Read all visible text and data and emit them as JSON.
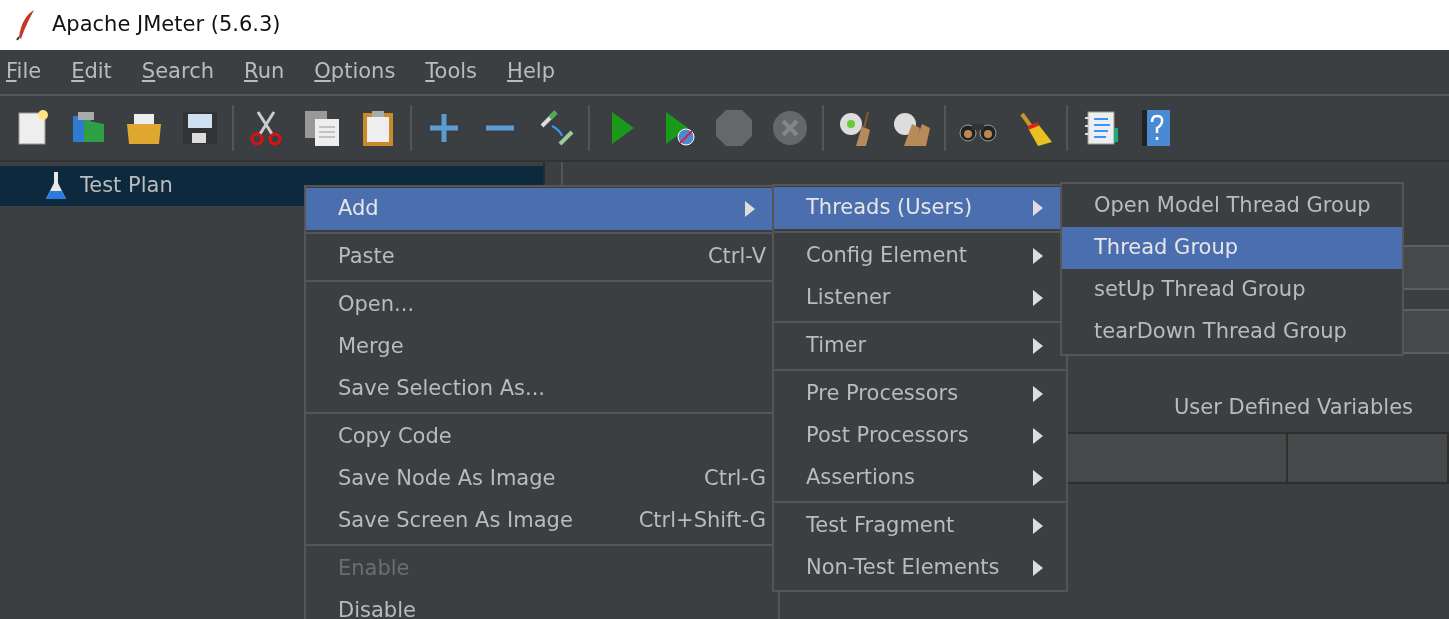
{
  "window": {
    "title": "Apache JMeter (5.6.3)"
  },
  "menu_bar": [
    "File",
    "Edit",
    "Search",
    "Run",
    "Options",
    "Tools",
    "Help"
  ],
  "toolbar": [
    {
      "kind": "new",
      "disabled": false
    },
    {
      "kind": "templates",
      "disabled": false
    },
    {
      "kind": "open",
      "disabled": false
    },
    {
      "kind": "save",
      "disabled": false
    },
    {
      "kind": "separator"
    },
    {
      "kind": "cut",
      "disabled": false
    },
    {
      "kind": "copy",
      "disabled": false
    },
    {
      "kind": "paste",
      "disabled": false
    },
    {
      "kind": "separator"
    },
    {
      "kind": "expand",
      "disabled": false
    },
    {
      "kind": "collapse",
      "disabled": false
    },
    {
      "kind": "toggle",
      "disabled": false
    },
    {
      "kind": "separator"
    },
    {
      "kind": "start",
      "disabled": false
    },
    {
      "kind": "start_no_pause",
      "disabled": false
    },
    {
      "kind": "stop",
      "disabled": true
    },
    {
      "kind": "shutdown",
      "disabled": true
    },
    {
      "kind": "separator"
    },
    {
      "kind": "clear",
      "disabled": false
    },
    {
      "kind": "clear_all",
      "disabled": false
    },
    {
      "kind": "separator"
    },
    {
      "kind": "search",
      "disabled": false
    },
    {
      "kind": "reset_search",
      "disabled": false
    },
    {
      "kind": "separator"
    },
    {
      "kind": "function_helper",
      "disabled": false
    },
    {
      "kind": "help",
      "disabled": false
    }
  ],
  "tree": [
    {
      "label": "Test Plan",
      "selected": true
    }
  ],
  "right_panel": {
    "section_title": "User Defined Variables"
  },
  "context_menu": {
    "items": [
      {
        "kind": "item",
        "label": "Add",
        "selected": true,
        "disabled": false,
        "has_submenu": true
      },
      {
        "kind": "separator"
      },
      {
        "kind": "item",
        "label": "Paste",
        "shortcut": "Ctrl-V",
        "selected": false,
        "disabled": false,
        "has_submenu": false
      },
      {
        "kind": "separator"
      },
      {
        "kind": "item",
        "label": "Open...",
        "selected": false,
        "disabled": false,
        "has_submenu": false
      },
      {
        "kind": "item",
        "label": "Merge",
        "selected": false,
        "disabled": false,
        "has_submenu": false
      },
      {
        "kind": "item",
        "label": "Save Selection As...",
        "selected": false,
        "disabled": false,
        "has_submenu": false
      },
      {
        "kind": "separator"
      },
      {
        "kind": "item",
        "label": "Copy Code",
        "selected": false,
        "disabled": false,
        "has_submenu": false
      },
      {
        "kind": "item",
        "label": "Save Node As Image",
        "shortcut": "Ctrl-G",
        "selected": false,
        "disabled": false,
        "has_submenu": false
      },
      {
        "kind": "item",
        "label": "Save Screen As Image",
        "shortcut": "Ctrl+Shift-G",
        "selected": false,
        "disabled": false,
        "has_submenu": false
      },
      {
        "kind": "separator"
      },
      {
        "kind": "item",
        "label": "Enable",
        "selected": false,
        "disabled": true,
        "has_submenu": false
      },
      {
        "kind": "item",
        "label": "Disable",
        "selected": false,
        "disabled": false,
        "has_submenu": false
      }
    ]
  },
  "add_submenu": {
    "items": [
      {
        "kind": "item",
        "label": "Threads (Users)",
        "selected": true,
        "disabled": false,
        "has_submenu": true
      },
      {
        "kind": "separator"
      },
      {
        "kind": "item",
        "label": "Config Element",
        "selected": false,
        "disabled": false,
        "has_submenu": true
      },
      {
        "kind": "item",
        "label": "Listener",
        "selected": false,
        "disabled": false,
        "has_submenu": true
      },
      {
        "kind": "separator"
      },
      {
        "kind": "item",
        "label": "Timer",
        "selected": false,
        "disabled": false,
        "has_submenu": true
      },
      {
        "kind": "separator"
      },
      {
        "kind": "item",
        "label": "Pre Processors",
        "selected": false,
        "disabled": false,
        "has_submenu": true
      },
      {
        "kind": "item",
        "label": "Post Processors",
        "selected": false,
        "disabled": false,
        "has_submenu": true
      },
      {
        "kind": "item",
        "label": "Assertions",
        "selected": false,
        "disabled": false,
        "has_submenu": true
      },
      {
        "kind": "separator"
      },
      {
        "kind": "item",
        "label": "Test Fragment",
        "selected": false,
        "disabled": false,
        "has_submenu": true
      },
      {
        "kind": "item",
        "label": "Non-Test Elements",
        "selected": false,
        "disabled": false,
        "has_submenu": true
      }
    ]
  },
  "threads_submenu": {
    "items": [
      {
        "kind": "item",
        "label": "Open Model Thread Group",
        "selected": false,
        "disabled": false,
        "has_submenu": false
      },
      {
        "kind": "item",
        "label": "Thread Group",
        "selected": true,
        "disabled": false,
        "has_submenu": false
      },
      {
        "kind": "item",
        "label": "setUp Thread Group",
        "selected": false,
        "disabled": false,
        "has_submenu": false
      },
      {
        "kind": "item",
        "label": "tearDown Thread Group",
        "selected": false,
        "disabled": false,
        "has_submenu": false
      }
    ]
  }
}
